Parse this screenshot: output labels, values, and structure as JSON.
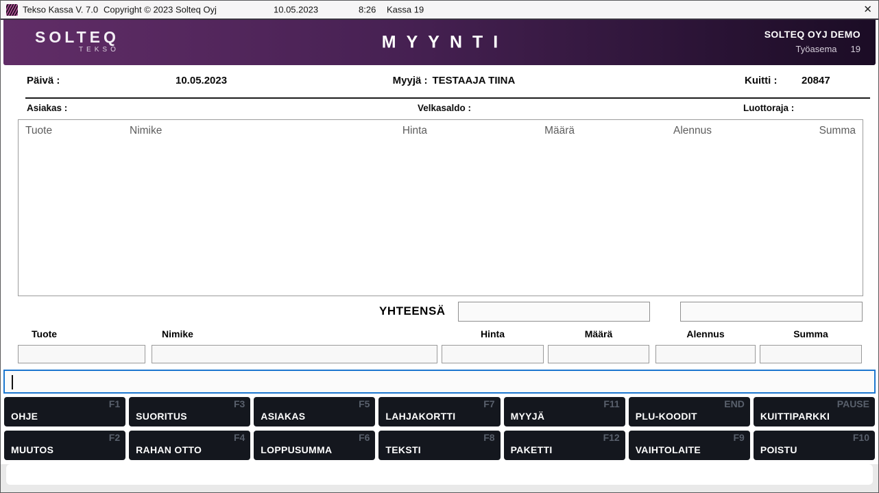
{
  "titlebar": {
    "app_title": "Tekso Kassa V. 7.0",
    "copyright": "Copyright © 2023 Solteq Oyj",
    "date": "10.05.2023",
    "time": "8:26",
    "register": "Kassa 19",
    "close_glyph": "✕"
  },
  "header": {
    "logo": "SOLTEQ",
    "logo_sub": "TEKSO",
    "title": "MYYNTI",
    "company": "SOLTEQ OYJ DEMO",
    "workstation_label": "Työasema",
    "workstation_value": "19"
  },
  "info": {
    "date_label": "Päivä :",
    "date_value": "10.05.2023",
    "seller_label": "Myyjä :",
    "seller_value": "TESTAAJA TIINA",
    "receipt_label": "Kuitti :",
    "receipt_value": "20847",
    "customer_label": "Asiakas :",
    "debt_label": "Velkasaldo :",
    "credit_label": "Luottoraja :"
  },
  "table": {
    "columns": [
      "Tuote",
      "Nimike",
      "Hinta",
      "Määrä",
      "Alennus",
      "Summa"
    ],
    "rows": []
  },
  "totals": {
    "label": "YHTEENSÄ",
    "total_value": "",
    "secondary_value": ""
  },
  "entry": {
    "fields": [
      {
        "label": "Tuote",
        "value": ""
      },
      {
        "label": "Nimike",
        "value": ""
      },
      {
        "label": "Hinta",
        "value": ""
      },
      {
        "label": "Määrä",
        "value": ""
      },
      {
        "label": "Alennus",
        "value": ""
      },
      {
        "label": "Summa",
        "value": ""
      }
    ],
    "command_value": ""
  },
  "function_keys": {
    "row1": [
      {
        "label": "OHJE",
        "key": "F1"
      },
      {
        "label": "SUORITUS",
        "key": "F3"
      },
      {
        "label": "ASIAKAS",
        "key": "F5"
      },
      {
        "label": "LAHJAKORTTI",
        "key": "F7"
      },
      {
        "label": "MYYJÄ",
        "key": "F11"
      },
      {
        "label": "PLU-KOODIT",
        "key": "END"
      },
      {
        "label": "KUITTIPARKKI",
        "key": "PAUSE"
      }
    ],
    "row2": [
      {
        "label": "MUUTOS",
        "key": "F2"
      },
      {
        "label": "RAHAN OTTO",
        "key": "F4"
      },
      {
        "label": "LOPPUSUMMA",
        "key": "F6"
      },
      {
        "label": "TEKSTI",
        "key": "F8"
      },
      {
        "label": "PAKETTI",
        "key": "F12"
      },
      {
        "label": "VAIHTOLAITE",
        "key": "F9"
      },
      {
        "label": "POISTU",
        "key": "F10"
      }
    ]
  },
  "colors": {
    "header_gradient_start": "#612d67",
    "header_gradient_mid": "#472153",
    "header_gradient_end": "#1b0c25",
    "button_bg": "#14171e",
    "button_key_text": "#59606c",
    "focus_border": "#1b76cf",
    "icon_stripe": "#b5519b"
  }
}
